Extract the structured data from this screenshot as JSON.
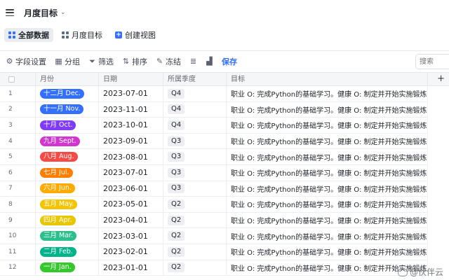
{
  "header": {
    "title": "月度目标"
  },
  "views": [
    {
      "label": "全部数据",
      "active": true
    },
    {
      "label": "月度目标",
      "active": false
    },
    {
      "label": "创建视图",
      "active": false
    }
  ],
  "toolbar": {
    "field_settings": "字段设置",
    "group": "分组",
    "filter": "筛选",
    "sort": "排序",
    "freeze": "冻结",
    "save": "保存",
    "search_placeholder": "搜索"
  },
  "columns": [
    "月份",
    "日期",
    "所属季度",
    "目标"
  ],
  "rows": [
    {
      "num": "1",
      "month": "十二月 Dec.",
      "color": "#3370ff",
      "date": "2023-07-01",
      "quarter": "Q4",
      "goal": "职业 O: 完成Python的基础学习。健康 O: 制定并开始实施锻炼计划。"
    },
    {
      "num": "2",
      "month": "十一月 Nov.",
      "color": "#3370ff",
      "date": "2023-11-01",
      "quarter": "Q4",
      "goal": "职业 O: 完成Python的基础学习。健康 O: 制定并开始实施锻炼计划。"
    },
    {
      "num": "3",
      "month": "十月 Oct.",
      "color": "#7f3bf5",
      "date": "2023-10-01",
      "quarter": "Q4",
      "goal": "职业 O: 完成Python的基础学习。健康 O: 制定并开始实施锻炼计划。"
    },
    {
      "num": "4",
      "month": "九月 Sept.",
      "color": "#d136d1",
      "date": "2023-09-01",
      "quarter": "Q3",
      "goal": "职业 O: 完成Python的基础学习。健康 O: 制定并开始实施锻炼计划。"
    },
    {
      "num": "5",
      "month": "八月 Aug.",
      "color": "#f54a45",
      "date": "2023-08-01",
      "quarter": "Q3",
      "goal": "职业 O: 完成Python的基础学习。健康 O: 制定并开始实施锻炼计划。"
    },
    {
      "num": "6",
      "month": "七月 Jul.",
      "color": "#ff7d00",
      "date": "2023-07-01",
      "quarter": "Q3",
      "goal": "职业 O: 完成Python的基础学习。健康 O: 制定并开始实施锻炼计划。"
    },
    {
      "num": "7",
      "month": "六月 Jun.",
      "color": "#ffaa00",
      "date": "2023-06-01",
      "quarter": "Q3",
      "goal": "职业 O: 完成Python的基础学习。健康 O: 制定并开始实施锻炼计划。"
    },
    {
      "num": "8",
      "month": "五月 May.",
      "color": "#f5c400",
      "date": "2023-05-01",
      "quarter": "Q2",
      "goal": "职业 O: 完成Python的基础学习。健康 O: 制定并开始实施锻炼计划。"
    },
    {
      "num": "9",
      "month": "四月 Apr.",
      "color": "#e8c600",
      "date": "2023-04-01",
      "quarter": "Q2",
      "goal": "职业 O: 完成Python的基础学习。健康 O: 制定并开始实施锻炼计划。"
    },
    {
      "num": "10",
      "month": "三月 Mar.",
      "color": "#2bbf8e",
      "date": "2023-03-01",
      "quarter": "Q2",
      "goal": "职业 O: 完成Python的基础学习。健康 O: 制定并开始实施锻炼计划。"
    },
    {
      "num": "11",
      "month": "二月 Feb.",
      "color": "#00b38a",
      "date": "2023-02-01",
      "quarter": "Q2",
      "goal": "职业 O: 完成Python的基础学习。健康 O: 制定并开始实施锻炼计划。"
    },
    {
      "num": "12",
      "month": "一月 Jan.",
      "color": "#35c82c",
      "date": "2023-01-01",
      "quarter": "Q2",
      "goal": "职业 O: 完成Python的基础学习。健康 O: 制定并开始实施锻炼计划。"
    }
  ],
  "watermark": "@伙伴云"
}
